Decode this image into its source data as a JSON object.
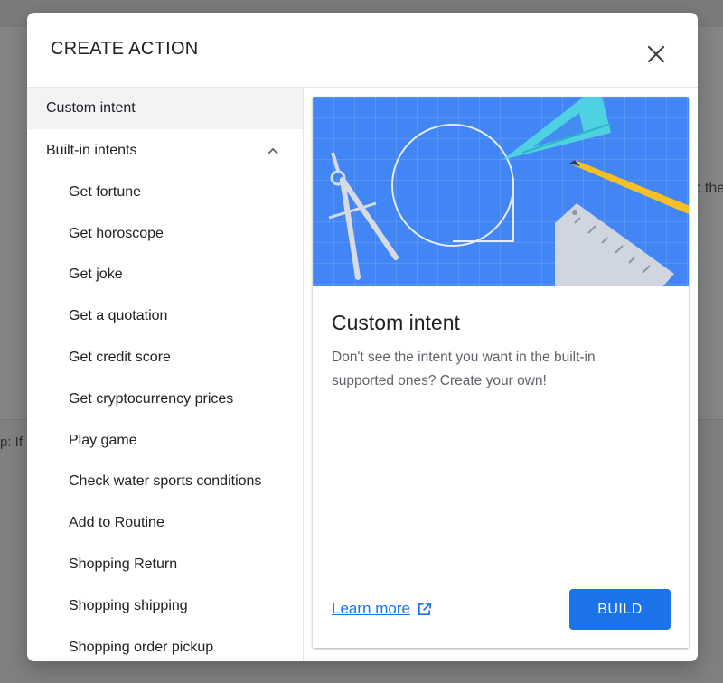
{
  "background": {
    "right_fragment": ": the",
    "left_fragment": "p: If"
  },
  "dialog": {
    "title": "CREATE ACTION",
    "close_icon": "close-icon"
  },
  "sidebar": {
    "custom_intent_label": "Custom intent",
    "builtin_label": "Built-in intents",
    "builtin_chevron_icon": "chevron-up-icon",
    "items": [
      {
        "label": "Get fortune"
      },
      {
        "label": "Get horoscope"
      },
      {
        "label": "Get joke"
      },
      {
        "label": "Get a quotation"
      },
      {
        "label": "Get credit score"
      },
      {
        "label": "Get cryptocurrency prices"
      },
      {
        "label": "Play game"
      },
      {
        "label": "Check water sports conditions"
      },
      {
        "label": "Add to Routine"
      },
      {
        "label": "Shopping Return"
      },
      {
        "label": "Shopping shipping"
      },
      {
        "label": "Shopping order pickup"
      }
    ]
  },
  "detail": {
    "title": "Custom intent",
    "description": "Don't see the intent you want in the built-in supported ones? Create your own!",
    "learn_more_label": "Learn more",
    "learn_more_icon": "open-in-new-icon",
    "build_label": "BUILD"
  },
  "colors": {
    "accent": "#1a73e8",
    "hero_blue": "#4285f4",
    "selected_bg": "#f1f3f4"
  }
}
